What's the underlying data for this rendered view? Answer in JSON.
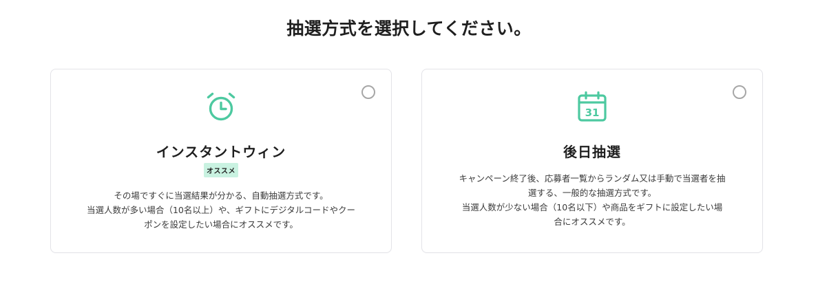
{
  "page": {
    "title": "抽選方式を選択してください。"
  },
  "colors": {
    "accent": "#4dc9a0",
    "badge_bg": "#c9f2e1",
    "card_border": "#e3e3e8",
    "radio_border": "#a6a6a6"
  },
  "cards": [
    {
      "icon": "alarm-clock-icon",
      "heading": "インスタントウィン",
      "badge": "オススメ",
      "description_lines": [
        "その場ですぐに当選結果が分かる、自動抽選方式です。",
        "当選人数が多い場合（10名以上）や、ギフトにデジタルコードやクー",
        "ポンを設定したい場合にオススメです。"
      ],
      "selected": false
    },
    {
      "icon": "calendar-icon",
      "icon_text": "31",
      "heading": "後日抽選",
      "description_lines": [
        "キャンペーン終了後、応募者一覧からランダム又は手動で当選者を抽",
        "選する、一般的な抽選方式です。",
        "当選人数が少ない場合（10名以下）や商品をギフトに設定したい場",
        "合にオススメです。"
      ],
      "selected": false
    }
  ]
}
